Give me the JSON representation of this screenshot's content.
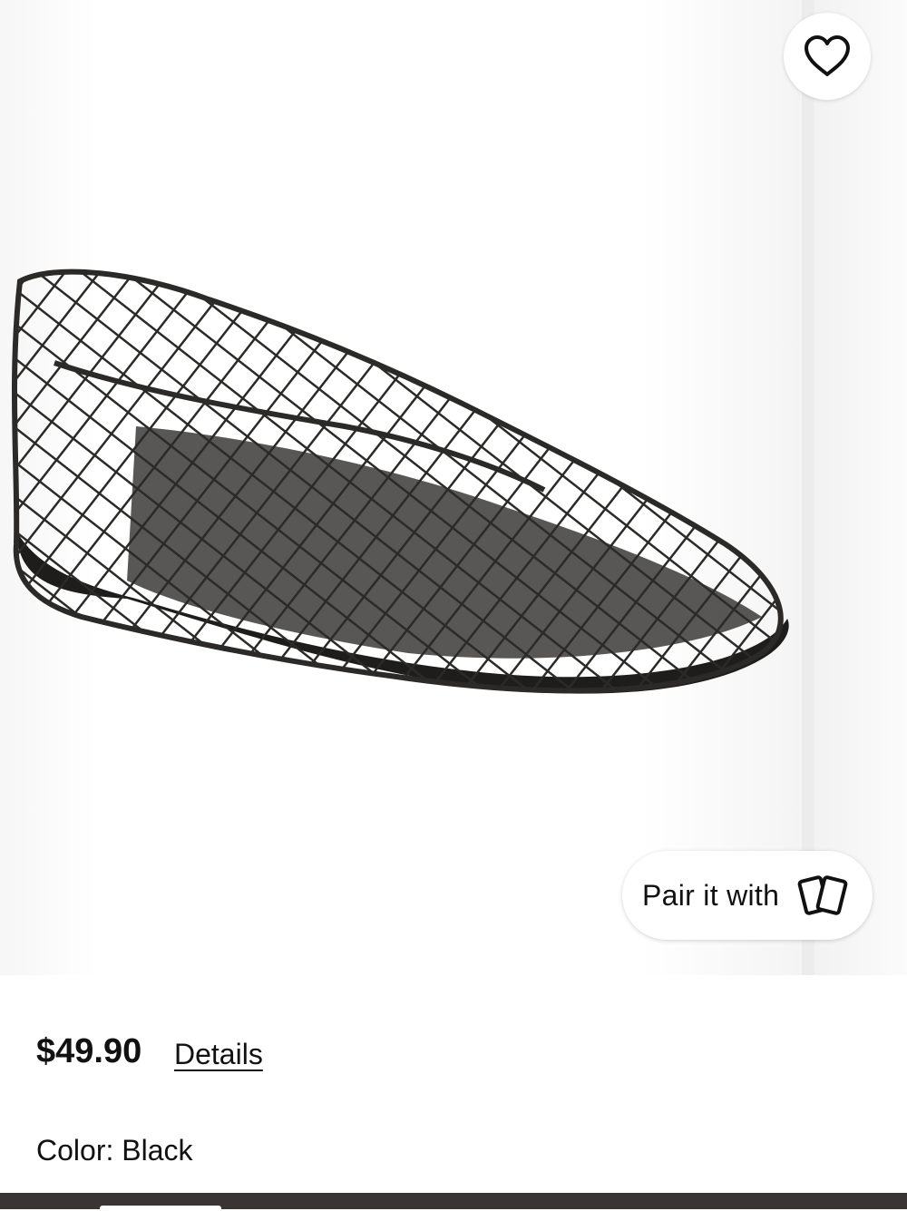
{
  "product": {
    "price": "$49.90",
    "details_label": "Details",
    "color_label": "Color: Black"
  },
  "gallery": {
    "favorite_icon": "heart-icon",
    "pair_label": "Pair it with",
    "pair_icon": "cards-icon"
  },
  "colors": {
    "shoe": "#2b2a28",
    "text": "#111111",
    "bottom_bar": "#3a3535"
  }
}
